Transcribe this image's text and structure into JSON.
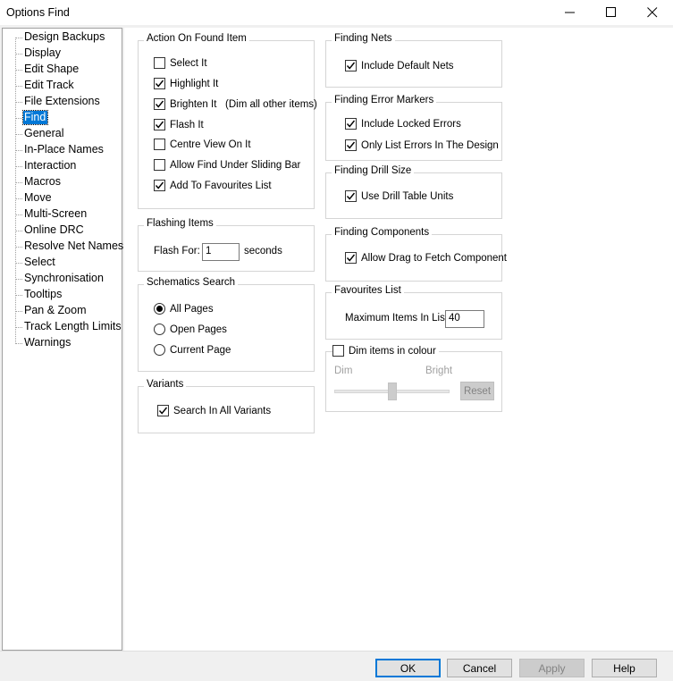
{
  "window": {
    "title": "Options  Find"
  },
  "tree": {
    "items": [
      {
        "label": "Design Backups"
      },
      {
        "label": "Display"
      },
      {
        "label": "Edit Shape"
      },
      {
        "label": "Edit Track"
      },
      {
        "label": "File Extensions"
      },
      {
        "label": "Find"
      },
      {
        "label": "General"
      },
      {
        "label": "In-Place Names"
      },
      {
        "label": "Interaction"
      },
      {
        "label": "Macros"
      },
      {
        "label": "Move"
      },
      {
        "label": "Multi-Screen"
      },
      {
        "label": "Online DRC"
      },
      {
        "label": "Resolve Net Names"
      },
      {
        "label": "Select"
      },
      {
        "label": "Synchronisation"
      },
      {
        "label": "Tooltips"
      },
      {
        "label": "Pan & Zoom"
      },
      {
        "label": "Track Length Limits"
      },
      {
        "label": "Warnings"
      }
    ],
    "selected": "Find"
  },
  "action_on_found": {
    "title": "Action On Found Item",
    "options": [
      {
        "label": "Select It",
        "checked": false
      },
      {
        "label": "Highlight It",
        "checked": true
      },
      {
        "label": "Brighten It   (Dim all other items)",
        "checked": true
      },
      {
        "label": "Flash It",
        "checked": true
      },
      {
        "label": "Centre View On It",
        "checked": false
      },
      {
        "label": "Allow Find Under Sliding Bar",
        "checked": false
      },
      {
        "label": "Add To Favourites List",
        "checked": true
      }
    ]
  },
  "flashing": {
    "title": "Flashing Items",
    "flash_for_label": "Flash For:",
    "flash_for_value": "1",
    "seconds_label": "seconds"
  },
  "schematics_search": {
    "title": "Schematics Search",
    "options": [
      {
        "label": "All Pages",
        "selected": true
      },
      {
        "label": "Open Pages",
        "selected": false
      },
      {
        "label": "Current Page",
        "selected": false
      }
    ]
  },
  "variants": {
    "title": "Variants",
    "search_all_label": "Search In All Variants",
    "search_all_checked": true
  },
  "finding_nets": {
    "title": "Finding Nets",
    "include_default_label": "Include Default Nets",
    "include_default_checked": true
  },
  "finding_error_markers": {
    "title": "Finding Error Markers",
    "include_locked_label": "Include Locked Errors",
    "include_locked_checked": true,
    "only_list_label": "Only List Errors In The Design",
    "only_list_checked": true
  },
  "finding_drill": {
    "title": "Finding Drill Size",
    "use_drill_label": "Use Drill Table Units",
    "use_drill_checked": true
  },
  "finding_components": {
    "title": "Finding Components",
    "allow_drag_label": "Allow Drag to Fetch Component",
    "allow_drag_checked": true
  },
  "favourites": {
    "title": "Favourites List",
    "max_label": "Maximum Items In List:",
    "max_value": "40"
  },
  "dim": {
    "title": "Dim items in colour",
    "checked": false,
    "dim_label": "Dim",
    "bright_label": "Bright",
    "slider_level": 0.5,
    "reset_label": "Reset"
  },
  "footer": {
    "ok": "OK",
    "cancel": "Cancel",
    "apply": "Apply",
    "help": "Help"
  }
}
